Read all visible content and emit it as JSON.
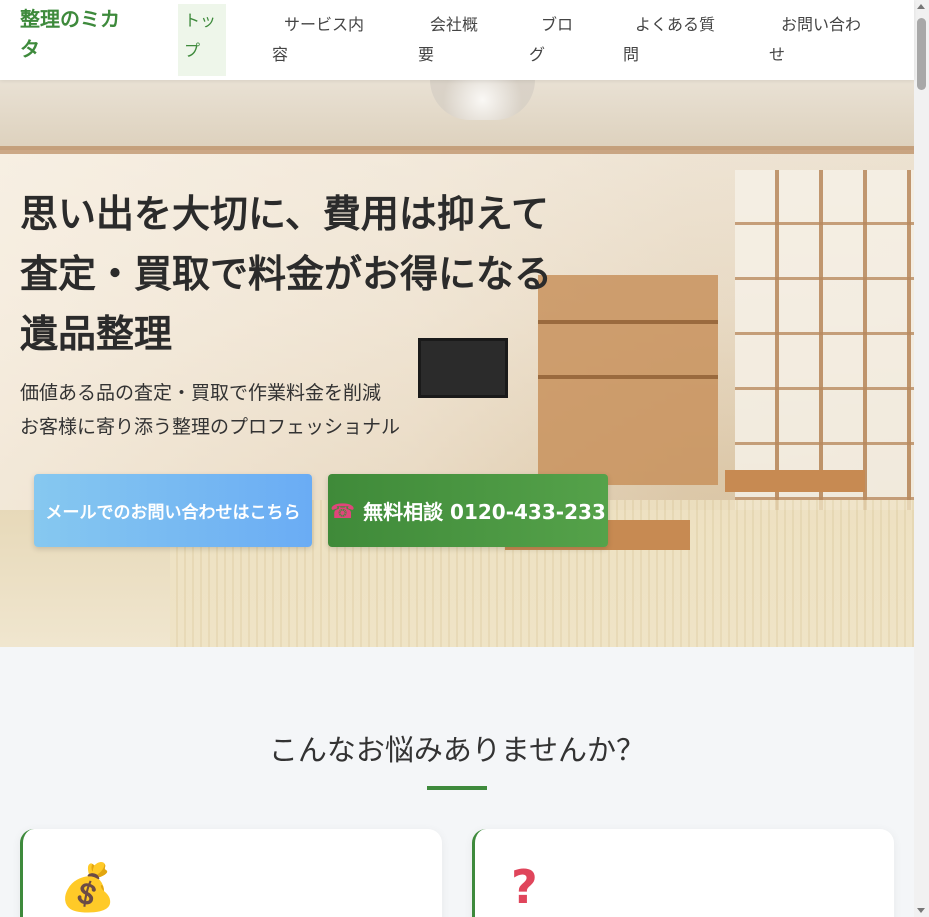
{
  "header": {
    "logo_line1": "整理のミカ",
    "logo_line2": "タ",
    "nav": [
      {
        "line1": "トッ",
        "line2": "プ"
      },
      {
        "line1": "サービス内",
        "line2": "容"
      },
      {
        "line1": "会社概",
        "line2": "要"
      },
      {
        "line1": "ブロ",
        "line2": "グ"
      },
      {
        "line1": "よくある質",
        "line2": "問"
      },
      {
        "line1": "お問い合わ",
        "line2": "せ"
      }
    ]
  },
  "hero": {
    "title_lines": [
      "思い出を大切に、費用は抑えて",
      "査定・買取で料金がお得になる",
      "遺品整理"
    ],
    "sub_lines": [
      "価値ある品の査定・買取で作業料金を削減",
      "お客様に寄り添う整理のプロフェッショナル"
    ],
    "mail_button": "メールでのお問い合わせはこちら",
    "tel_button": "無料相談 0120-433-233",
    "tel_icon": "☎"
  },
  "section": {
    "title": "こんなお悩みありませんか？",
    "cards": [
      {
        "icon": "money-bag-icon",
        "glyph": "💰"
      },
      {
        "icon": "question-icon",
        "glyph": "?"
      }
    ]
  },
  "colors": {
    "brand_green": "#3e8a3c",
    "mail_blue": "#6aacf4",
    "card_bg": "#ffffff"
  }
}
